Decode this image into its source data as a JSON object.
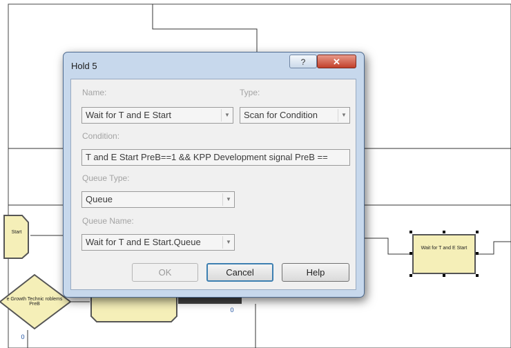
{
  "dialog": {
    "title": "Hold 5",
    "help_glyph": "?",
    "close_glyph": "✕",
    "name_label": "Name:",
    "name_value": "Wait for T and E Start",
    "type_label": "Type:",
    "type_value": "Scan for Condition",
    "condition_label": "Condition:",
    "condition_value": "T and E Start PreB==1 && KPP Development signal PreB ==",
    "queue_type_label": "Queue Type:",
    "queue_type_value": "Queue",
    "queue_name_label": "Queue Name:",
    "queue_name_value": "Wait for T and E Start.Queue",
    "ok_label": "OK",
    "cancel_label": "Cancel",
    "help_label": "Help"
  },
  "canvas": {
    "hold_module_label": "Wait for T and E Start",
    "left_module_label": "Start",
    "decide_label": "e Growth Technic roblems PreB",
    "counter_left": "0",
    "counter_mid": "0",
    "dropdown_glyph": "▼"
  }
}
